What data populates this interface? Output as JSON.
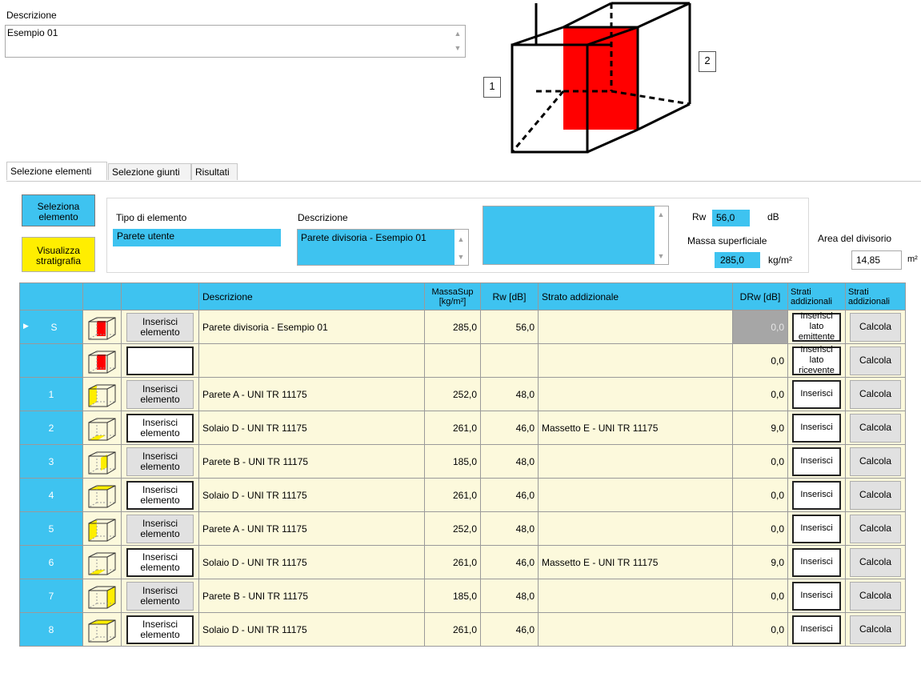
{
  "description": {
    "label": "Descrizione",
    "value": "Esempio 01"
  },
  "diagram": {
    "label_1": "1",
    "label_2": "2",
    "accent": "#ff0000"
  },
  "tabs": [
    {
      "label": "Selezione elementi",
      "active": true
    },
    {
      "label": "Selezione giunti",
      "active": false
    },
    {
      "label": "Risultati",
      "active": false
    }
  ],
  "buttons": {
    "select_element": "Seleziona elemento",
    "show_stratigraphy": "Visualizza stratigrafia"
  },
  "element": {
    "type_label": "Tipo di elemento",
    "type_value": "Parete utente",
    "desc_label": "Descrizione",
    "desc_value": "Parete divisoria - Esempio 01",
    "notes_value": "",
    "rw_label": "Rw",
    "rw_value": "56,0",
    "rw_unit": "dB",
    "mass_label": "Massa superficiale",
    "mass_value": "285,0",
    "mass_unit": "kg/m²",
    "area_label": "Area del divisorio",
    "area_value": "14,85",
    "area_unit": "m²"
  },
  "table": {
    "headers": {
      "descrizione": "Descrizione",
      "massa": "MassaSup [kg/m²]",
      "rw": "Rw [dB]",
      "strato": "Strato addizionale",
      "drw": "DRw [dB]",
      "strati1": "Strati addizionali",
      "strati2": "Strati addizionali"
    },
    "rows": [
      {
        "id": "S",
        "marker": "▶",
        "insert": "Inserisci elemento",
        "insert_style": "gray",
        "desc": "Parete divisoria - Esempio 01",
        "mass": "285,0",
        "rw": "56,0",
        "layer": "",
        "drw": "0,0",
        "drw_gray": true,
        "strati": "Inserisci lato emittente",
        "calc": "Calcola",
        "thumb": "red-front"
      },
      {
        "id": "",
        "marker": "",
        "insert": "",
        "insert_style": "white",
        "desc": "",
        "mass": "",
        "rw": "",
        "layer": "",
        "drw": "0,0",
        "drw_gray": false,
        "strati": "Inserisci lato ricevente",
        "calc": "Calcola",
        "thumb": "red-front"
      },
      {
        "id": "1",
        "marker": "",
        "insert": "Inserisci elemento",
        "insert_style": "gray",
        "desc": "Parete A - UNI TR 11175",
        "mass": "252,0",
        "rw": "48,0",
        "layer": "",
        "drw": "0,0",
        "drw_gray": false,
        "strati": "Inserisci",
        "calc": "Calcola",
        "thumb": "yellow-left"
      },
      {
        "id": "2",
        "marker": "",
        "insert": "Inserisci elemento",
        "insert_style": "white",
        "desc": "Solaio D - UNI TR 11175",
        "mass": "261,0",
        "rw": "46,0",
        "layer": "Massetto E - UNI TR 11175",
        "drw": "9,0",
        "drw_gray": false,
        "strati": "Inserisci",
        "calc": "Calcola",
        "thumb": "yellow-bottom"
      },
      {
        "id": "3",
        "marker": "",
        "insert": "Inserisci elemento",
        "insert_style": "gray",
        "desc": "Parete B - UNI TR 11175",
        "mass": "185,0",
        "rw": "48,0",
        "layer": "",
        "drw": "0,0",
        "drw_gray": false,
        "strati": "Inserisci",
        "calc": "Calcola",
        "thumb": "yellow-back"
      },
      {
        "id": "4",
        "marker": "",
        "insert": "Inserisci elemento",
        "insert_style": "white",
        "desc": "Solaio D - UNI TR 11175",
        "mass": "261,0",
        "rw": "46,0",
        "layer": "",
        "drw": "0,0",
        "drw_gray": false,
        "strati": "Inserisci",
        "calc": "Calcola",
        "thumb": "yellow-top"
      },
      {
        "id": "5",
        "marker": "",
        "insert": "Inserisci elemento",
        "insert_style": "gray",
        "desc": "Parete A - UNI TR 11175",
        "mass": "252,0",
        "rw": "48,0",
        "layer": "",
        "drw": "0,0",
        "drw_gray": false,
        "strati": "Inserisci",
        "calc": "Calcola",
        "thumb": "yellow-left"
      },
      {
        "id": "6",
        "marker": "",
        "insert": "Inserisci elemento",
        "insert_style": "white",
        "desc": "Solaio D - UNI TR 11175",
        "mass": "261,0",
        "rw": "46,0",
        "layer": "Massetto E - UNI TR 11175",
        "drw": "9,0",
        "drw_gray": false,
        "strati": "Inserisci",
        "calc": "Calcola",
        "thumb": "yellow-bottom"
      },
      {
        "id": "7",
        "marker": "",
        "insert": "Inserisci elemento",
        "insert_style": "gray",
        "desc": "Parete B - UNI TR 11175",
        "mass": "185,0",
        "rw": "48,0",
        "layer": "",
        "drw": "0,0",
        "drw_gray": false,
        "strati": "Inserisci",
        "calc": "Calcola",
        "thumb": "yellow-right"
      },
      {
        "id": "8",
        "marker": "",
        "insert": "Inserisci elemento",
        "insert_style": "white",
        "desc": "Solaio D - UNI TR 11175",
        "mass": "261,0",
        "rw": "46,0",
        "layer": "",
        "drw": "0,0",
        "drw_gray": false,
        "strati": "Inserisci",
        "calc": "Calcola",
        "thumb": "yellow-top"
      }
    ]
  }
}
